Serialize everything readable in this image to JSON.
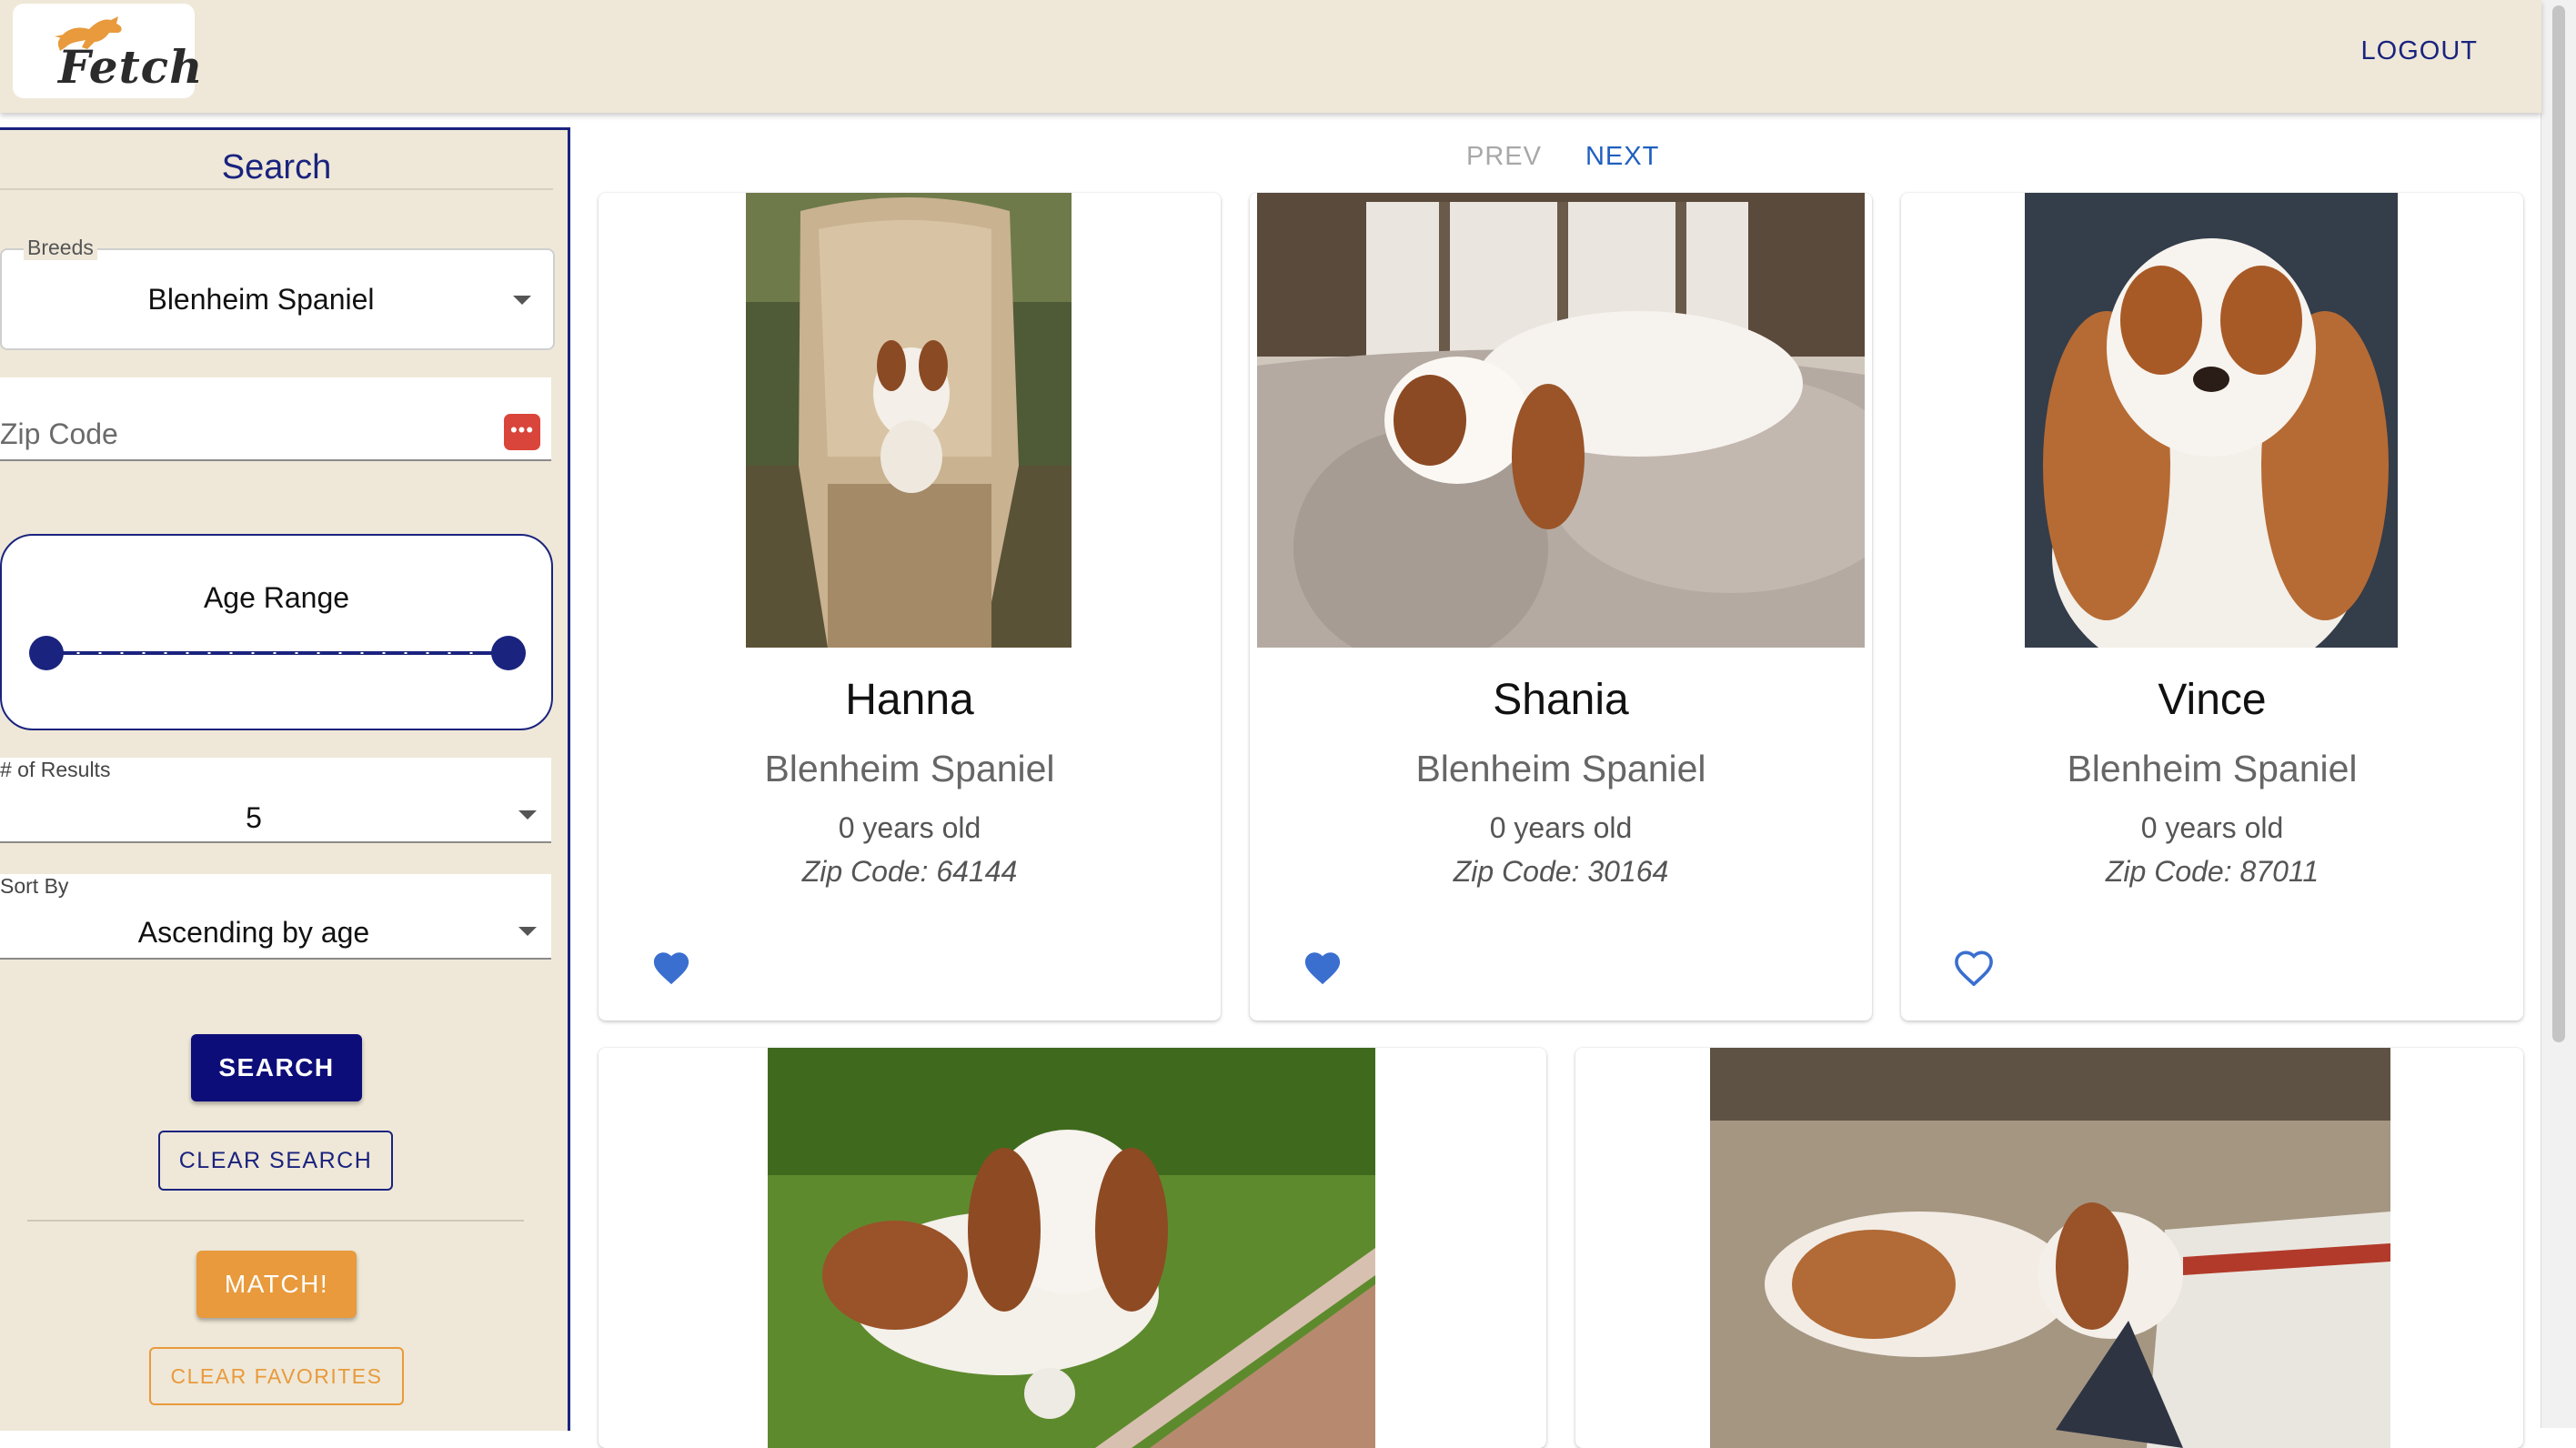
{
  "header": {
    "logo_text": "Fetch",
    "logout_label": "LOGOUT"
  },
  "sidebar": {
    "title": "Search",
    "breeds": {
      "label": "Breeds",
      "value": "Blenheim Spaniel"
    },
    "zip": {
      "placeholder": "Zip Code"
    },
    "age_range": {
      "label": "Age Range"
    },
    "results": {
      "label": "# of Results",
      "value": "5"
    },
    "sort": {
      "label": "Sort By",
      "value": "Ascending by age"
    },
    "search_button": "SEARCH",
    "clear_search_button": "CLEAR SEARCH",
    "match_button": "MATCH!",
    "clear_favorites_button": "CLEAR FAVORITES"
  },
  "pager": {
    "prev": "PREV",
    "next": "NEXT"
  },
  "dogs": [
    {
      "name": "Hanna",
      "breed": "Blenheim Spaniel",
      "age": "0 years old",
      "zip": "Zip Code: 64144",
      "favorite": true
    },
    {
      "name": "Shania",
      "breed": "Blenheim Spaniel",
      "age": "0 years old",
      "zip": "Zip Code: 30164",
      "favorite": true
    },
    {
      "name": "Vince",
      "breed": "Blenheim Spaniel",
      "age": "0 years old",
      "zip": "Zip Code: 87011",
      "favorite": false
    },
    {
      "name": "",
      "breed": "",
      "age": "",
      "zip": "",
      "favorite": false
    },
    {
      "name": "",
      "breed": "",
      "age": "",
      "zip": "",
      "favorite": false
    }
  ],
  "colors": {
    "navy": "#1a237e",
    "beige": "#efe8d8",
    "orange": "#e89a3c",
    "heart_blue": "#3a6fd0"
  }
}
